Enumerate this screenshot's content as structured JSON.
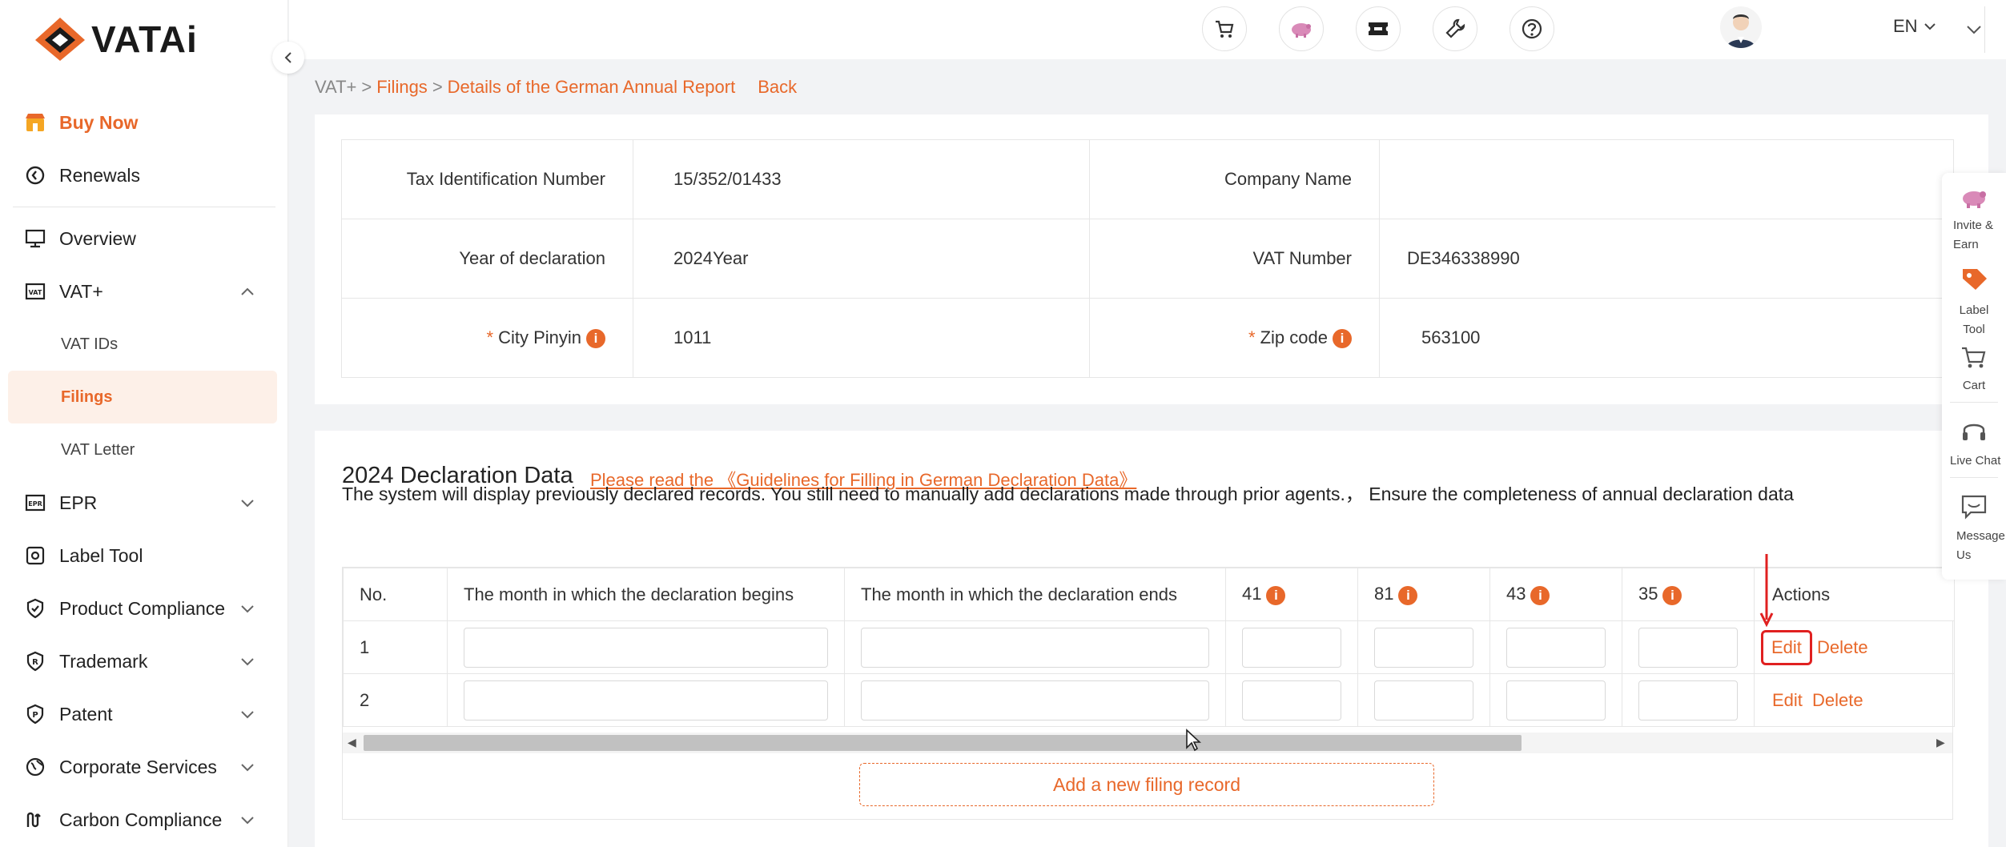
{
  "brand": {
    "name": "VATAi"
  },
  "sidebar": {
    "buy_now": "Buy Now",
    "renewals": "Renewals",
    "items": [
      {
        "label": "Overview"
      },
      {
        "label": "VAT+"
      },
      {
        "label": "EPR"
      },
      {
        "label": "Label Tool"
      },
      {
        "label": "Product Compliance"
      },
      {
        "label": "Trademark"
      },
      {
        "label": "Patent"
      },
      {
        "label": "Corporate Services"
      },
      {
        "label": "Carbon Compliance"
      }
    ],
    "vat_sub": [
      "VAT IDs",
      "Filings",
      "VAT Letter"
    ]
  },
  "topbar": {
    "language": "EN"
  },
  "breadcrumb": {
    "root": "VAT+",
    "filings": "Filings",
    "current": "Details of the German Annual Report",
    "back": "Back"
  },
  "info": {
    "tin_label": "Tax Identification Number",
    "tin_value": "15/352/01433",
    "company_label": "Company Name",
    "company_value": "",
    "year_label": "Year of declaration",
    "year_value": "2024Year",
    "vat_label": "VAT Number",
    "vat_value": "DE346338990",
    "required": "*",
    "city_label": "City Pinyin",
    "city_value": "1011",
    "zip_label": "Zip code",
    "zip_value": "563100",
    "info_glyph": "i"
  },
  "declaration": {
    "title": "2024 Declaration Data",
    "guide_link": "Please read the 《Guidelines for Filling in German Declaration Data》",
    "description": "The system will display previously declared records. You still need to manually add declarations made through prior agents.， Ensure the completeness of annual declaration data",
    "columns": {
      "no": "No.",
      "begin": "The month in which the declaration begins",
      "end": "The month in which the declaration ends",
      "c41": "41",
      "c81": "81",
      "c43": "43",
      "c35": "35",
      "actions": "Actions"
    },
    "rows": [
      {
        "no": "1",
        "edit": "Edit",
        "delete": "Delete"
      },
      {
        "no": "2",
        "edit": "Edit",
        "delete": "Delete"
      }
    ],
    "add_button": "Add a new filing record"
  },
  "float_panel": {
    "invite": "Invite & Earn",
    "label_tool": "Label Tool",
    "cart": "Cart",
    "live_chat": "Live Chat",
    "message": "Message Us"
  },
  "colors": {
    "accent": "#e8682a",
    "highlight": "#e02020"
  }
}
